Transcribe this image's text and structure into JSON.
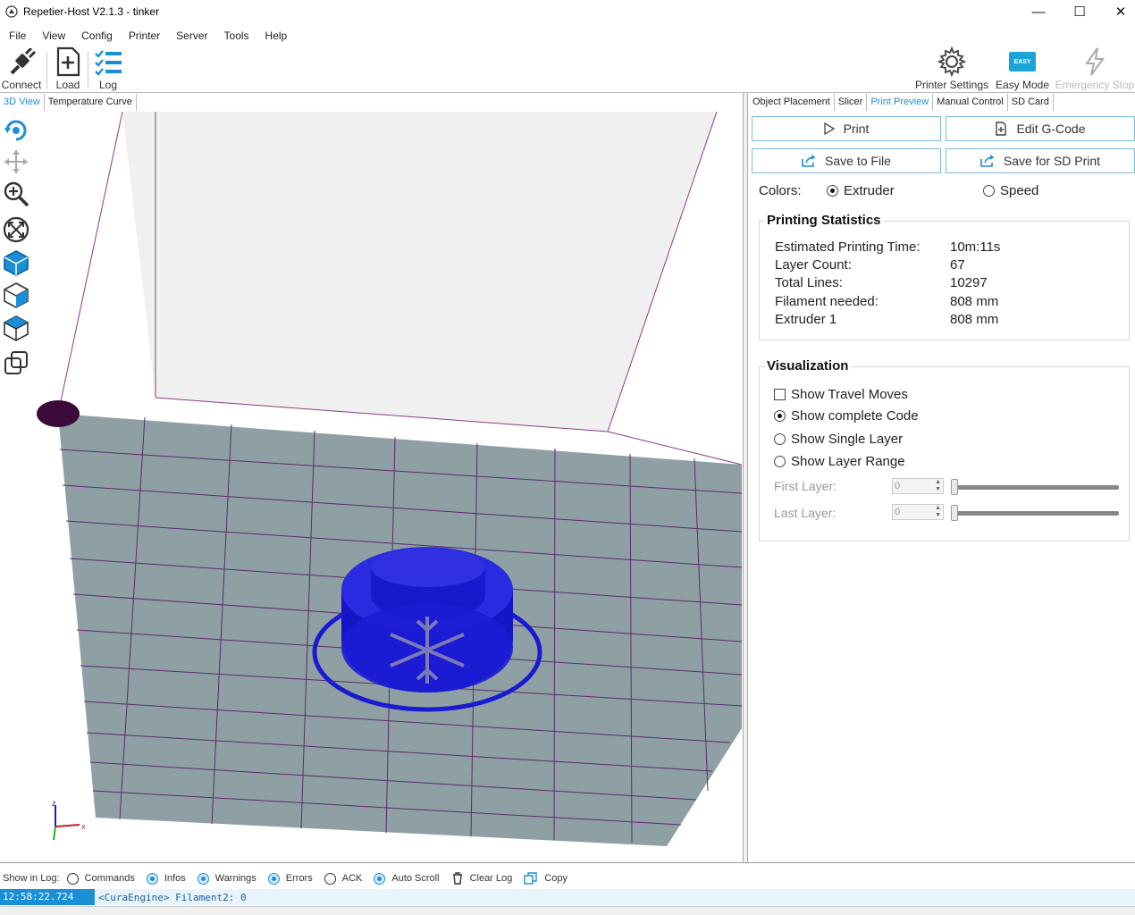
{
  "window": {
    "title": "Repetier-Host V2.1.3 - tinker",
    "minimize": "—",
    "maximize": "☐",
    "close": "✕"
  },
  "menu": [
    "File",
    "View",
    "Config",
    "Printer",
    "Server",
    "Tools",
    "Help"
  ],
  "toolbar": {
    "connect": "Connect",
    "load": "Load",
    "log": "Log",
    "printer_settings": "Printer Settings",
    "easy_mode": "Easy Mode",
    "easy_badge": "EASY",
    "emergency_stop": "Emergency Stop"
  },
  "left_tabs": [
    "3D View",
    "Temperature Curve"
  ],
  "right_tabs": [
    "Object Placement",
    "Slicer",
    "Print Preview",
    "Manual Control",
    "SD Card"
  ],
  "active_right_tab": "Print Preview",
  "actions": {
    "print": "Print",
    "edit_gcode": "Edit G-Code",
    "save_file": "Save to File",
    "save_sd": "Save for SD Print"
  },
  "colors": {
    "label": "Colors:",
    "extruder": "Extruder",
    "speed": "Speed",
    "selected": "Extruder"
  },
  "stats": {
    "title": "Printing Statistics",
    "rows": [
      {
        "label": "Estimated Printing Time:",
        "value": "10m:11s"
      },
      {
        "label": "Layer Count:",
        "value": "67"
      },
      {
        "label": "Total Lines:",
        "value": "10297"
      },
      {
        "label": "Filament needed:",
        "value": "808 mm"
      },
      {
        "label": "Extruder 1",
        "value": "808 mm"
      }
    ]
  },
  "visualization": {
    "title": "Visualization",
    "show_travel": "Show Travel Moves",
    "show_complete": "Show complete Code",
    "show_single": "Show Single Layer",
    "show_range": "Show Layer Range",
    "first_layer": "First Layer:",
    "last_layer": "Last Layer:",
    "first_value": "0",
    "last_value": "0"
  },
  "log": {
    "show_in_log": "Show in Log:",
    "commands": "Commands",
    "infos": "Infos",
    "warnings": "Warnings",
    "errors": "Errors",
    "ack": "ACK",
    "auto_scroll": "Auto Scroll",
    "clear_log": "Clear Log",
    "copy": "Copy",
    "entry_time": "12:58:22.724",
    "entry_msg": "<CuraEngine> Filament2: 0"
  },
  "axis": {
    "z": "z",
    "x": "x"
  },
  "colors_theme": {
    "accent": "#1a8fd8",
    "bed": "#8fa0a4",
    "grid": "#5a2a6a",
    "model": "#1a1ad0"
  }
}
